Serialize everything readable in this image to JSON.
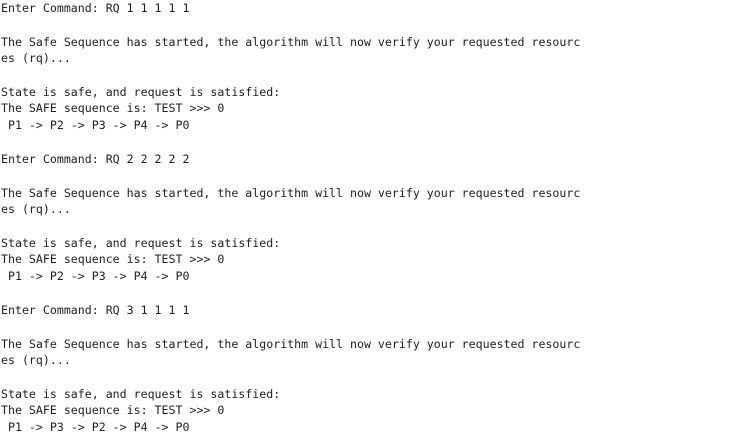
{
  "console": {
    "blocks": [
      {
        "command": "Enter Command: RQ 1 1 1 1 1",
        "started_line1": "The Safe Sequence has started, the algorithm will now verify your requested resourc",
        "started_line2": "es (rq)...",
        "state": "State is safe, and request is satisfied:",
        "safe_header": "The SAFE sequence is: TEST >>> 0",
        "sequence": " P1 -> P2 -> P3 -> P4 -> P0"
      },
      {
        "command": "Enter Command: RQ 2 2 2 2 2",
        "started_line1": "The Safe Sequence has started, the algorithm will now verify your requested resourc",
        "started_line2": "es (rq)...",
        "state": "State is safe, and request is satisfied:",
        "safe_header": "The SAFE sequence is: TEST >>> 0",
        "sequence": " P1 -> P2 -> P3 -> P4 -> P0"
      },
      {
        "command": "Enter Command: RQ 3 1 1 1 1",
        "started_line1": "The Safe Sequence has started, the algorithm will now verify your requested resourc",
        "started_line2": "es (rq)...",
        "state": "State is safe, and request is satisfied:",
        "safe_header": "The SAFE sequence is: TEST >>> 0",
        "sequence": " P1 -> P3 -> P2 -> P4 -> P0"
      }
    ]
  }
}
